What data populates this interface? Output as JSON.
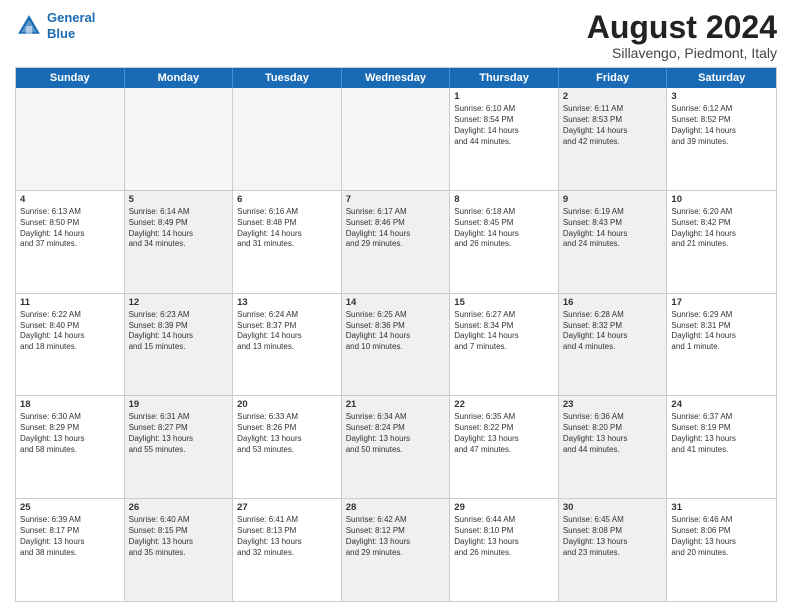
{
  "header": {
    "logo_line1": "General",
    "logo_line2": "Blue",
    "title": "August 2024",
    "subtitle": "Sillavengo, Piedmont, Italy"
  },
  "days_of_week": [
    "Sunday",
    "Monday",
    "Tuesday",
    "Wednesday",
    "Thursday",
    "Friday",
    "Saturday"
  ],
  "weeks": [
    [
      {
        "day": "",
        "info": "",
        "empty": true
      },
      {
        "day": "",
        "info": "",
        "empty": true
      },
      {
        "day": "",
        "info": "",
        "empty": true
      },
      {
        "day": "",
        "info": "",
        "empty": true
      },
      {
        "day": "1",
        "info": "Sunrise: 6:10 AM\nSunset: 8:54 PM\nDaylight: 14 hours\nand 44 minutes.",
        "shaded": false
      },
      {
        "day": "2",
        "info": "Sunrise: 6:11 AM\nSunset: 8:53 PM\nDaylight: 14 hours\nand 42 minutes.",
        "shaded": true
      },
      {
        "day": "3",
        "info": "Sunrise: 6:12 AM\nSunset: 8:52 PM\nDaylight: 14 hours\nand 39 minutes.",
        "shaded": false
      }
    ],
    [
      {
        "day": "4",
        "info": "Sunrise: 6:13 AM\nSunset: 8:50 PM\nDaylight: 14 hours\nand 37 minutes.",
        "shaded": false
      },
      {
        "day": "5",
        "info": "Sunrise: 6:14 AM\nSunset: 8:49 PM\nDaylight: 14 hours\nand 34 minutes.",
        "shaded": true
      },
      {
        "day": "6",
        "info": "Sunrise: 6:16 AM\nSunset: 8:48 PM\nDaylight: 14 hours\nand 31 minutes.",
        "shaded": false
      },
      {
        "day": "7",
        "info": "Sunrise: 6:17 AM\nSunset: 8:46 PM\nDaylight: 14 hours\nand 29 minutes.",
        "shaded": true
      },
      {
        "day": "8",
        "info": "Sunrise: 6:18 AM\nSunset: 8:45 PM\nDaylight: 14 hours\nand 26 minutes.",
        "shaded": false
      },
      {
        "day": "9",
        "info": "Sunrise: 6:19 AM\nSunset: 8:43 PM\nDaylight: 14 hours\nand 24 minutes.",
        "shaded": true
      },
      {
        "day": "10",
        "info": "Sunrise: 6:20 AM\nSunset: 8:42 PM\nDaylight: 14 hours\nand 21 minutes.",
        "shaded": false
      }
    ],
    [
      {
        "day": "11",
        "info": "Sunrise: 6:22 AM\nSunset: 8:40 PM\nDaylight: 14 hours\nand 18 minutes.",
        "shaded": false
      },
      {
        "day": "12",
        "info": "Sunrise: 6:23 AM\nSunset: 8:39 PM\nDaylight: 14 hours\nand 15 minutes.",
        "shaded": true
      },
      {
        "day": "13",
        "info": "Sunrise: 6:24 AM\nSunset: 8:37 PM\nDaylight: 14 hours\nand 13 minutes.",
        "shaded": false
      },
      {
        "day": "14",
        "info": "Sunrise: 6:25 AM\nSunset: 8:36 PM\nDaylight: 14 hours\nand 10 minutes.",
        "shaded": true
      },
      {
        "day": "15",
        "info": "Sunrise: 6:27 AM\nSunset: 8:34 PM\nDaylight: 14 hours\nand 7 minutes.",
        "shaded": false
      },
      {
        "day": "16",
        "info": "Sunrise: 6:28 AM\nSunset: 8:32 PM\nDaylight: 14 hours\nand 4 minutes.",
        "shaded": true
      },
      {
        "day": "17",
        "info": "Sunrise: 6:29 AM\nSunset: 8:31 PM\nDaylight: 14 hours\nand 1 minute.",
        "shaded": false
      }
    ],
    [
      {
        "day": "18",
        "info": "Sunrise: 6:30 AM\nSunset: 8:29 PM\nDaylight: 13 hours\nand 58 minutes.",
        "shaded": false
      },
      {
        "day": "19",
        "info": "Sunrise: 6:31 AM\nSunset: 8:27 PM\nDaylight: 13 hours\nand 55 minutes.",
        "shaded": true
      },
      {
        "day": "20",
        "info": "Sunrise: 6:33 AM\nSunset: 8:26 PM\nDaylight: 13 hours\nand 53 minutes.",
        "shaded": false
      },
      {
        "day": "21",
        "info": "Sunrise: 6:34 AM\nSunset: 8:24 PM\nDaylight: 13 hours\nand 50 minutes.",
        "shaded": true
      },
      {
        "day": "22",
        "info": "Sunrise: 6:35 AM\nSunset: 8:22 PM\nDaylight: 13 hours\nand 47 minutes.",
        "shaded": false
      },
      {
        "day": "23",
        "info": "Sunrise: 6:36 AM\nSunset: 8:20 PM\nDaylight: 13 hours\nand 44 minutes.",
        "shaded": true
      },
      {
        "day": "24",
        "info": "Sunrise: 6:37 AM\nSunset: 8:19 PM\nDaylight: 13 hours\nand 41 minutes.",
        "shaded": false
      }
    ],
    [
      {
        "day": "25",
        "info": "Sunrise: 6:39 AM\nSunset: 8:17 PM\nDaylight: 13 hours\nand 38 minutes.",
        "shaded": false
      },
      {
        "day": "26",
        "info": "Sunrise: 6:40 AM\nSunset: 8:15 PM\nDaylight: 13 hours\nand 35 minutes.",
        "shaded": true
      },
      {
        "day": "27",
        "info": "Sunrise: 6:41 AM\nSunset: 8:13 PM\nDaylight: 13 hours\nand 32 minutes.",
        "shaded": false
      },
      {
        "day": "28",
        "info": "Sunrise: 6:42 AM\nSunset: 8:12 PM\nDaylight: 13 hours\nand 29 minutes.",
        "shaded": true
      },
      {
        "day": "29",
        "info": "Sunrise: 6:44 AM\nSunset: 8:10 PM\nDaylight: 13 hours\nand 26 minutes.",
        "shaded": false
      },
      {
        "day": "30",
        "info": "Sunrise: 6:45 AM\nSunset: 8:08 PM\nDaylight: 13 hours\nand 23 minutes.",
        "shaded": true
      },
      {
        "day": "31",
        "info": "Sunrise: 6:46 AM\nSunset: 8:06 PM\nDaylight: 13 hours\nand 20 minutes.",
        "shaded": false
      }
    ]
  ]
}
